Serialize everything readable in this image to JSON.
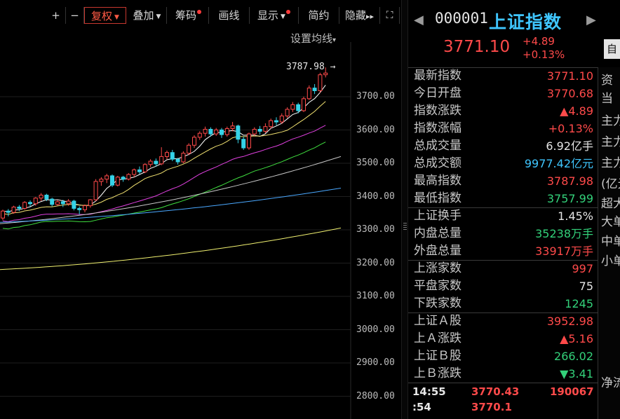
{
  "toolbar": {
    "plus": "+",
    "minus": "−",
    "fuquan": "复权",
    "diejia": "叠加",
    "chouma": "筹码",
    "huaxian": "画线",
    "xianshi": "显示",
    "jianyue": "简约",
    "yincang": "隐藏",
    "hide_arrows": "▸▸",
    "fullscreen": "⛶"
  },
  "chart": {
    "ma_setting": "设置均线",
    "ma_setting_arrow": "▾",
    "high_label": "3787.98",
    "high_arrow": "→",
    "y_ticks": [
      "3700.00",
      "3600.00",
      "3500.00",
      "3400.00",
      "3300.00",
      "3200.00",
      "3100.00",
      "3000.00",
      "2900.00",
      "2800.00"
    ],
    "colors": {
      "up": "#ff4a4a",
      "down": "#35d3e8",
      "ma5": "#ffffff",
      "ma10": "#f0e070",
      "ma20": "#e040e0",
      "ma30": "#40e040",
      "ma60": "#c8c8c8",
      "ma120": "#4aa8ff",
      "ma250": "#f0f070"
    }
  },
  "chart_data": {
    "type": "candlestick",
    "title": "",
    "ylim": [
      2780,
      3800
    ],
    "high_marker": 3787.98,
    "candles": [
      [
        3335,
        3356,
        3328,
        3360
      ],
      [
        3356,
        3352,
        3340,
        3362
      ],
      [
        3352,
        3368,
        3348,
        3372
      ],
      [
        3368,
        3364,
        3356,
        3374
      ],
      [
        3364,
        3382,
        3360,
        3386
      ],
      [
        3382,
        3378,
        3370,
        3388
      ],
      [
        3378,
        3395,
        3372,
        3398
      ],
      [
        3395,
        3404,
        3386,
        3410
      ],
      [
        3404,
        3392,
        3386,
        3408
      ],
      [
        3392,
        3376,
        3370,
        3396
      ],
      [
        3376,
        3384,
        3372,
        3390
      ],
      [
        3384,
        3378,
        3368,
        3390
      ],
      [
        3378,
        3386,
        3372,
        3392
      ],
      [
        3386,
        3364,
        3358,
        3390
      ],
      [
        3364,
        3360,
        3346,
        3370
      ],
      [
        3360,
        3372,
        3352,
        3376
      ],
      [
        3372,
        3390,
        3366,
        3392
      ],
      [
        3390,
        3445,
        3386,
        3452
      ],
      [
        3445,
        3452,
        3432,
        3458
      ],
      [
        3452,
        3462,
        3440,
        3468
      ],
      [
        3462,
        3434,
        3428,
        3466
      ],
      [
        3434,
        3458,
        3430,
        3462
      ],
      [
        3458,
        3452,
        3444,
        3462
      ],
      [
        3452,
        3466,
        3448,
        3470
      ],
      [
        3466,
        3480,
        3458,
        3484
      ],
      [
        3480,
        3474,
        3468,
        3490
      ],
      [
        3474,
        3496,
        3470,
        3500
      ],
      [
        3496,
        3506,
        3488,
        3512
      ],
      [
        3506,
        3498,
        3490,
        3514
      ],
      [
        3498,
        3520,
        3494,
        3548
      ],
      [
        3520,
        3532,
        3512,
        3538
      ],
      [
        3532,
        3512,
        3506,
        3540
      ],
      [
        3512,
        3504,
        3496,
        3516
      ],
      [
        3504,
        3530,
        3500,
        3536
      ],
      [
        3530,
        3554,
        3524,
        3560
      ],
      [
        3554,
        3578,
        3546,
        3584
      ],
      [
        3578,
        3590,
        3570,
        3596
      ],
      [
        3590,
        3602,
        3580,
        3610
      ],
      [
        3602,
        3588,
        3580,
        3608
      ],
      [
        3588,
        3600,
        3582,
        3606
      ],
      [
        3600,
        3586,
        3576,
        3606
      ],
      [
        3586,
        3604,
        3580,
        3610
      ],
      [
        3604,
        3612,
        3596,
        3624
      ],
      [
        3612,
        3572,
        3560,
        3616
      ],
      [
        3572,
        3546,
        3540,
        3580
      ],
      [
        3546,
        3588,
        3540,
        3592
      ],
      [
        3588,
        3602,
        3582,
        3608
      ],
      [
        3602,
        3596,
        3586,
        3612
      ],
      [
        3596,
        3610,
        3590,
        3620
      ],
      [
        3610,
        3628,
        3604,
        3634
      ],
      [
        3628,
        3624,
        3614,
        3638
      ],
      [
        3624,
        3642,
        3618,
        3650
      ],
      [
        3642,
        3662,
        3636,
        3668
      ],
      [
        3662,
        3676,
        3654,
        3684
      ],
      [
        3676,
        3658,
        3650,
        3682
      ],
      [
        3658,
        3694,
        3654,
        3700
      ],
      [
        3694,
        3726,
        3690,
        3734
      ],
      [
        3726,
        3718,
        3708,
        3738
      ],
      [
        3718,
        3766,
        3712,
        3772
      ],
      [
        3766,
        3771.1,
        3757.99,
        3787.98
      ]
    ],
    "ma_end_values": {
      "ma5": 3742,
      "ma10": 3700,
      "ma20": 3650,
      "ma30": 3614,
      "ma60": 3520,
      "ma120": 3425,
      "ma250": 3305
    }
  },
  "panel": {
    "prev": "◀",
    "next": "▶",
    "code": "000001",
    "name": "上证指数",
    "price": "3771.10",
    "change": "+4.89",
    "change_pct": "+0.13%",
    "zi": "自",
    "rows": [
      {
        "label": "最新指数",
        "value": "3771.10",
        "cls": "red"
      },
      {
        "label": "今日开盘",
        "value": "3770.68",
        "cls": "red"
      },
      {
        "label": "指数涨跌",
        "value": "▲4.89",
        "cls": "red"
      },
      {
        "label": "指数涨幅",
        "value": "+0.13%",
        "cls": "red"
      },
      {
        "label": "总成交量",
        "value": "6.92亿手",
        "cls": "white"
      },
      {
        "label": "总成交额",
        "value": "9977.42亿元",
        "cls": "cyan"
      },
      {
        "label": "最高指数",
        "value": "3787.98",
        "cls": "red"
      },
      {
        "label": "最低指数",
        "value": "3757.99",
        "cls": "green"
      },
      {
        "label": "上证换手",
        "value": "1.45%",
        "cls": "white"
      },
      {
        "label": "内盘总量",
        "value": "35238万手",
        "cls": "green"
      },
      {
        "label": "外盘总量",
        "value": "33917万手",
        "cls": "red"
      },
      {
        "label": "上涨家数",
        "value": "997",
        "cls": "red"
      },
      {
        "label": "平盘家数",
        "value": "75",
        "cls": "white"
      },
      {
        "label": "下跌家数",
        "value": "1245",
        "cls": "green"
      },
      {
        "label": "上证Ａ股",
        "value": "3952.98",
        "cls": "red"
      },
      {
        "label": "上Ａ涨跌",
        "value": "▲5.16",
        "cls": "red"
      },
      {
        "label": "上证Ｂ股",
        "value": "266.02",
        "cls": "green"
      },
      {
        "label": "上Ｂ涨跌",
        "value": "▼3.41",
        "cls": "green"
      }
    ],
    "ticks": [
      {
        "time": "14:55",
        "price": "3770.43",
        "vol": "190067"
      },
      {
        "time": ":54",
        "price": "3770.1",
        "vol": ""
      }
    ],
    "far_right": [
      "资",
      "当",
      "主力",
      "主力",
      "主力",
      "(亿元",
      "超大",
      "大单",
      "中单",
      "小单",
      "净流"
    ]
  }
}
